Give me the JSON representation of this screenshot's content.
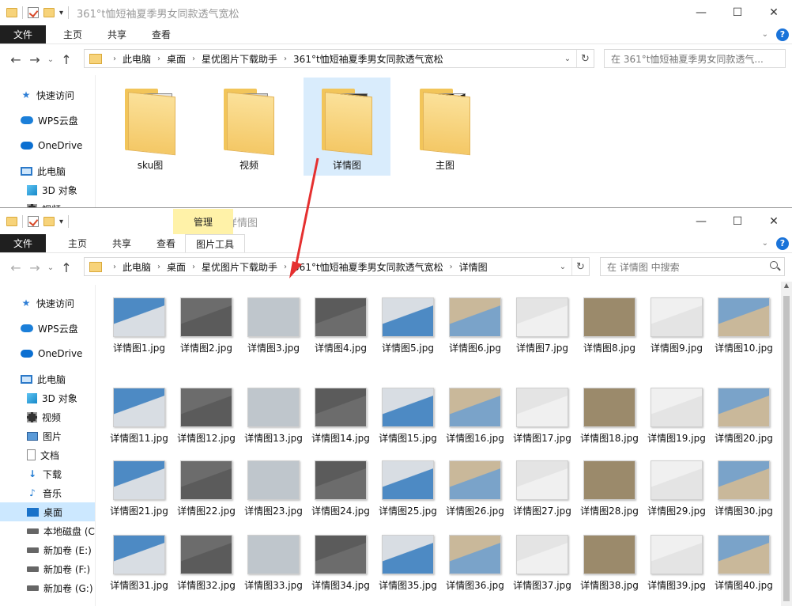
{
  "colors": {
    "accent": "#1a73d9",
    "selected_folder_bg": "#d9ecfc",
    "sidebar_selected_bg": "#cce8ff",
    "arrow": "#e53030",
    "manage_tab_bg": "#fff2a8"
  },
  "top_window": {
    "title": "361°t恤短袖夏季男女同款透气宽松",
    "ribbon": {
      "file": "文件",
      "home": "主页",
      "share": "共享",
      "view": "查看"
    },
    "breadcrumbs": [
      "此电脑",
      "桌面",
      "星优图片下载助手",
      "361°t恤短袖夏季男女同款透气宽松"
    ],
    "search_placeholder": "在 361°t恤短袖夏季男女同款透气...",
    "sidebar": [
      {
        "label": "快速访问",
        "icon": "star-icon"
      },
      {
        "label": "WPS云盘",
        "icon": "cloud-icon"
      },
      {
        "label": "OneDrive",
        "icon": "onedrive-icon"
      },
      {
        "label": "此电脑",
        "icon": "computer-icon"
      },
      {
        "label": "3D 对象",
        "icon": "cube-icon"
      },
      {
        "label": "视频",
        "icon": "video-icon"
      }
    ],
    "folders": [
      "sku图",
      "视频",
      "详情图",
      "主图"
    ]
  },
  "front_window": {
    "title": "详情图",
    "manage_tab": "管理",
    "ribbon": {
      "file": "文件",
      "home": "主页",
      "share": "共享",
      "view": "查看",
      "picture_tools": "图片工具"
    },
    "breadcrumbs": [
      "此电脑",
      "桌面",
      "星优图片下载助手",
      "361°t恤短袖夏季男女同款透气宽松",
      "详情图"
    ],
    "search_placeholder": "在 详情图 中搜索",
    "sidebar": [
      {
        "label": "快速访问",
        "icon": "star-icon"
      },
      {
        "label": "WPS云盘",
        "icon": "cloud-icon"
      },
      {
        "label": "OneDrive",
        "icon": "onedrive-icon"
      },
      {
        "label": "此电脑",
        "icon": "computer-icon"
      },
      {
        "label": "3D 对象",
        "icon": "cube-icon"
      },
      {
        "label": "视频",
        "icon": "video-icon"
      },
      {
        "label": "图片",
        "icon": "pictures-icon"
      },
      {
        "label": "文档",
        "icon": "documents-icon"
      },
      {
        "label": "下载",
        "icon": "download-icon"
      },
      {
        "label": "音乐",
        "icon": "music-icon"
      },
      {
        "label": "桌面",
        "icon": "desktop-icon"
      },
      {
        "label": "本地磁盘 (C",
        "icon": "disk-icon"
      },
      {
        "label": "新加卷 (E:)",
        "icon": "disk-icon"
      },
      {
        "label": "新加卷 (F:)",
        "icon": "disk-icon"
      },
      {
        "label": "新加卷 (G:)",
        "icon": "disk-icon"
      }
    ],
    "selected_sidebar": "桌面",
    "files": [
      "详情图1.jpg",
      "详情图2.jpg",
      "详情图3.jpg",
      "详情图4.jpg",
      "详情图5.jpg",
      "详情图6.jpg",
      "详情图7.jpg",
      "详情图8.jpg",
      "详情图9.jpg",
      "详情图10.jpg",
      "详情图11.jpg",
      "详情图12.jpg",
      "详情图13.jpg",
      "详情图14.jpg",
      "详情图15.jpg",
      "详情图16.jpg",
      "详情图17.jpg",
      "详情图18.jpg",
      "详情图19.jpg",
      "详情图20.jpg",
      "详情图21.jpg",
      "详情图22.jpg",
      "详情图23.jpg",
      "详情图24.jpg",
      "详情图25.jpg",
      "详情图26.jpg",
      "详情图27.jpg",
      "详情图28.jpg",
      "详情图29.jpg",
      "详情图30.jpg",
      "详情图31.jpg",
      "详情图32.jpg",
      "详情图33.jpg",
      "详情图34.jpg",
      "详情图35.jpg",
      "详情图36.jpg",
      "详情图37.jpg",
      "详情图38.jpg",
      "详情图39.jpg",
      "详情图40.jpg"
    ]
  }
}
